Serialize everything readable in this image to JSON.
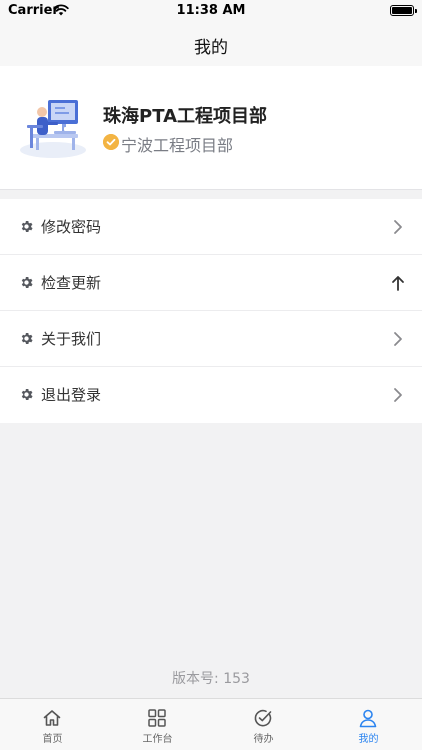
{
  "status_bar": {
    "carrier": "Carrier",
    "time": "11:38 AM"
  },
  "nav": {
    "title": "我的"
  },
  "profile": {
    "company": "珠海PTA工程项目部",
    "department": "宁波工程项目部",
    "verified_icon": "verified-check-icon",
    "avatar_icon": "workstation-illustration"
  },
  "menu": {
    "items": [
      {
        "label": "修改密码",
        "icon": "gear-icon",
        "trail": "chevron-right-icon"
      },
      {
        "label": "检查更新",
        "icon": "gear-icon",
        "trail": "arrow-up-icon"
      },
      {
        "label": "关于我们",
        "icon": "gear-icon",
        "trail": "chevron-right-icon"
      },
      {
        "label": "退出登录",
        "icon": "gear-icon",
        "trail": "chevron-right-icon"
      }
    ]
  },
  "version": "版本号: 153",
  "tabs": [
    {
      "label": "首页",
      "icon": "home-icon",
      "active": false
    },
    {
      "label": "工作台",
      "icon": "grid-icon",
      "active": false
    },
    {
      "label": "待办",
      "icon": "check-circle-icon",
      "active": false
    },
    {
      "label": "我的",
      "icon": "person-icon",
      "active": true
    }
  ],
  "colors": {
    "accent": "#2b84f0",
    "verified": "#f3b443",
    "background": "#f2f2f3"
  }
}
